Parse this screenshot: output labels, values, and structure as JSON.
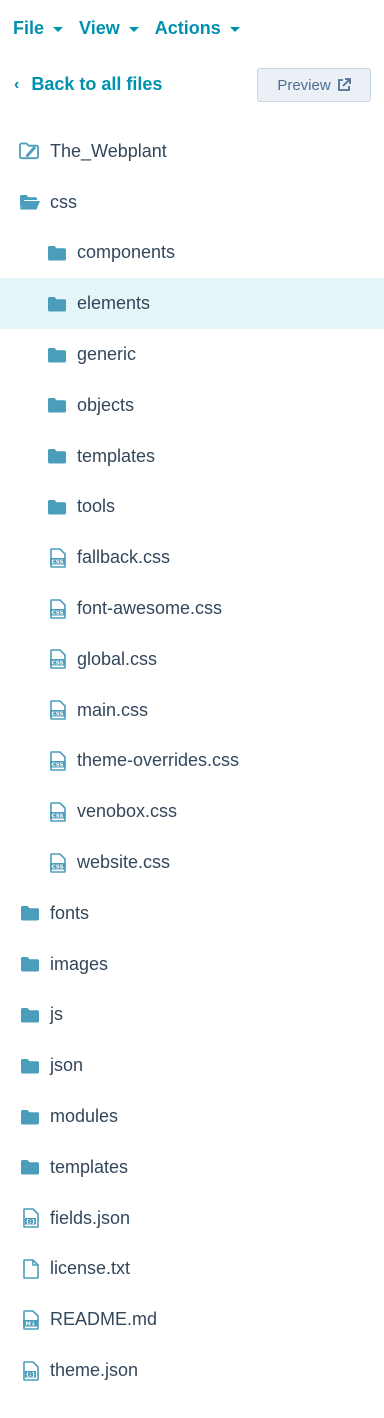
{
  "menu": {
    "file": "File",
    "view": "View",
    "actions": "Actions"
  },
  "nav": {
    "back": "Back to all files",
    "preview": "Preview"
  },
  "colors": {
    "accent": "#0091ae",
    "icon": "#4a9dbb",
    "text": "#33475b",
    "selected_bg": "#e5f5f8"
  },
  "tree": [
    {
      "label": "The_Webplant",
      "icon": "theme-folder-icon",
      "level": 0
    },
    {
      "label": "css",
      "icon": "folder-open-icon",
      "level": 0
    },
    {
      "label": "components",
      "icon": "folder-icon",
      "level": 1
    },
    {
      "label": "elements",
      "icon": "folder-icon",
      "level": 1,
      "selected": true
    },
    {
      "label": "generic",
      "icon": "folder-icon",
      "level": 1
    },
    {
      "label": "objects",
      "icon": "folder-icon",
      "level": 1
    },
    {
      "label": "templates",
      "icon": "folder-icon",
      "level": 1
    },
    {
      "label": "tools",
      "icon": "folder-icon",
      "level": 1
    },
    {
      "label": "fallback.css",
      "icon": "css-file-icon",
      "level": 1
    },
    {
      "label": "font-awesome.css",
      "icon": "css-file-icon",
      "level": 1
    },
    {
      "label": "global.css",
      "icon": "css-file-icon",
      "level": 1
    },
    {
      "label": "main.css",
      "icon": "css-file-icon",
      "level": 1
    },
    {
      "label": "theme-overrides.css",
      "icon": "css-file-icon",
      "level": 1
    },
    {
      "label": "venobox.css",
      "icon": "css-file-icon",
      "level": 1
    },
    {
      "label": "website.css",
      "icon": "css-file-icon",
      "level": 1
    },
    {
      "label": "fonts",
      "icon": "folder-icon",
      "level": 0
    },
    {
      "label": "images",
      "icon": "folder-icon",
      "level": 0
    },
    {
      "label": "js",
      "icon": "folder-icon",
      "level": 0
    },
    {
      "label": "json",
      "icon": "folder-icon",
      "level": 0
    },
    {
      "label": "modules",
      "icon": "folder-icon",
      "level": 0
    },
    {
      "label": "templates",
      "icon": "folder-icon",
      "level": 0
    },
    {
      "label": "fields.json",
      "icon": "json-file-icon",
      "level": 0
    },
    {
      "label": "license.txt",
      "icon": "text-file-icon",
      "level": 0
    },
    {
      "label": "README.md",
      "icon": "markdown-file-icon",
      "level": 0
    },
    {
      "label": "theme.json",
      "icon": "json-file-icon",
      "level": 0
    }
  ]
}
